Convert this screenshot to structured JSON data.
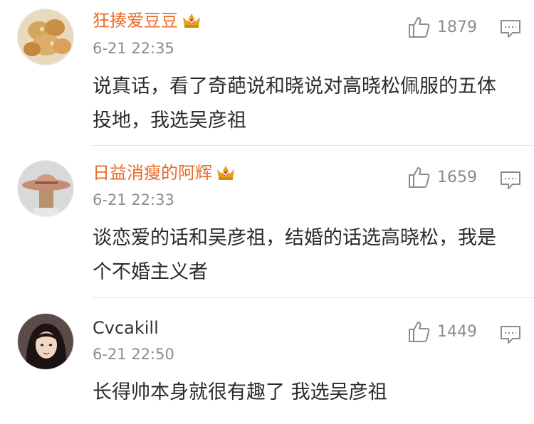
{
  "comments": [
    {
      "username": "狂揍爱豆豆",
      "vip": true,
      "timestamp": "6-21 22:35",
      "text": "说真话，看了奇葩说和晓说对高晓松佩服的五体投地，我选吴彦祖",
      "likes": "1879",
      "avatar_icon": "food-avatar",
      "name_color": "#e86b26"
    },
    {
      "username": "日益消瘦的阿辉",
      "vip": true,
      "timestamp": "6-21 22:33",
      "text": "谈恋爱的话和吴彦祖，结婚的话选高晓松，我是个不婚主义者",
      "likes": "1659",
      "avatar_icon": "cowboy-hat-avatar",
      "name_color": "#e86b26"
    },
    {
      "username": "Cvcakill",
      "vip": false,
      "timestamp": "6-21 22:50",
      "text": "长得帅本身就很有趣了 我选吴彦祖",
      "likes": "1449",
      "avatar_icon": "portrait-avatar",
      "name_color": "#333333"
    }
  ],
  "icons": {
    "like": "thumbs-up-icon",
    "reply": "comment-icon",
    "vip_badge": "crown-icon"
  },
  "colors": {
    "vip_name": "#e86b26",
    "crown": "#e8a11c",
    "meta": "#8c8c8c"
  }
}
